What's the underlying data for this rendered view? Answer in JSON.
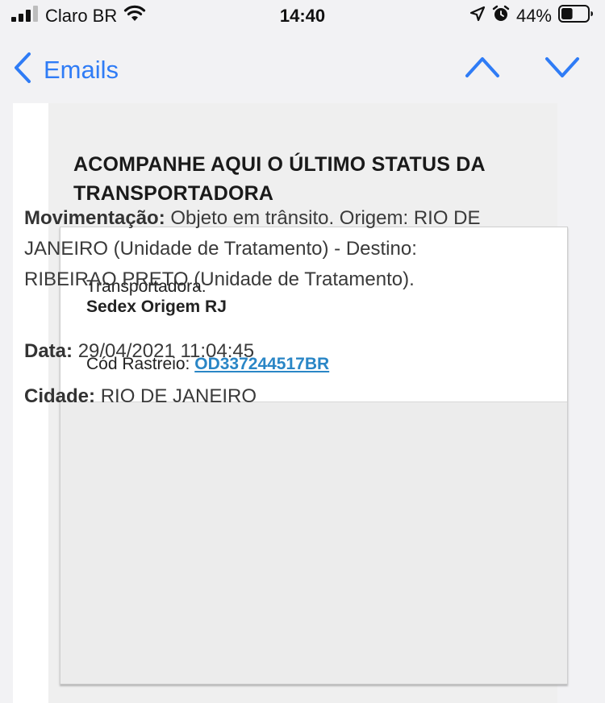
{
  "status_bar": {
    "carrier": "Claro BR",
    "time": "14:40",
    "battery_percent": "44%",
    "battery_level": 0.44
  },
  "nav": {
    "back_label": "Emails"
  },
  "email": {
    "heading": "ACOMPANHE AQUI O ÚLTIMO STATUS DA TRANSPORTADORA",
    "carrier_label": "Transportadora:",
    "carrier_value": "Sedex Origem RJ",
    "tracking_label": "Cód Rastreio:",
    "tracking_code": "OD337244517BR",
    "movement_label": "Movimentação:",
    "movement_text": "Objeto em trânsito. Origem: RIO DE JANEIRO (Unidade de Tratamento) - Destino: RIBEIRAO PRETO (Unidade de Tratamento).",
    "date_label": "Data:",
    "date_value": "29/04/2021 11:04:45",
    "city_label": "Cidade:",
    "city_value": "RIO DE JANEIRO"
  },
  "colors": {
    "accent": "#2f7cf6",
    "link": "#2a86c6"
  }
}
